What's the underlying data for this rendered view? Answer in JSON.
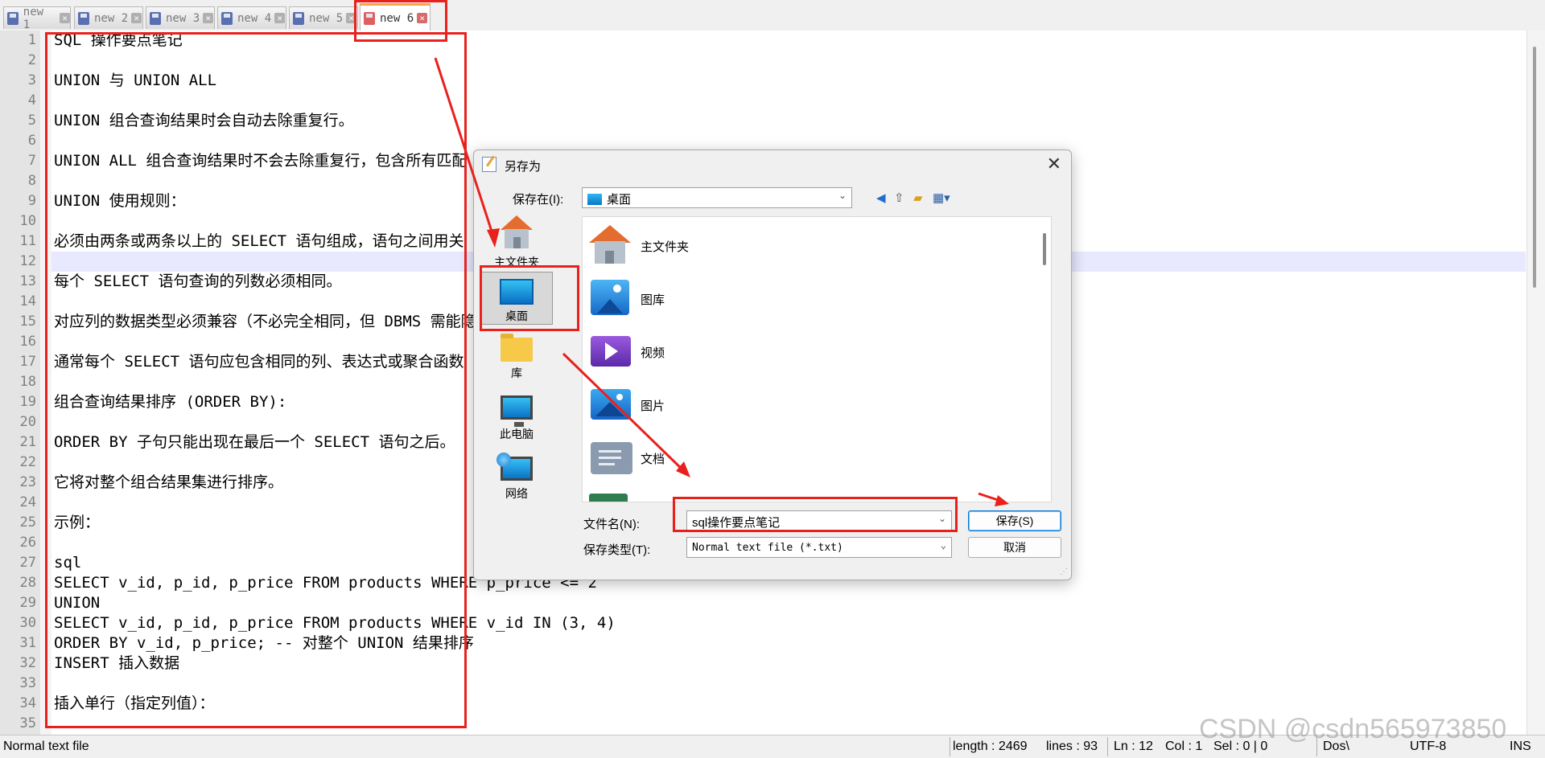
{
  "tabs": [
    {
      "label": "new 1"
    },
    {
      "label": "new 2"
    },
    {
      "label": "new 3"
    },
    {
      "label": "new 4"
    },
    {
      "label": "new 5"
    },
    {
      "label": "new 6",
      "active": true
    }
  ],
  "editor": {
    "line_numbers": [
      "1",
      "2",
      "3",
      "4",
      "5",
      "6",
      "7",
      "8",
      "9",
      "10",
      "11",
      "12",
      "13",
      "14",
      "15",
      "16",
      "17",
      "18",
      "19",
      "20",
      "21",
      "22",
      "23",
      "24",
      "25",
      "26",
      "27",
      "28",
      "29",
      "30",
      "31",
      "32",
      "33",
      "34",
      "35"
    ],
    "lines": [
      "SQL 操作要点笔记",
      "",
      "UNION 与 UNION ALL",
      "",
      "UNION 组合查询结果时会自动去除重复行。",
      "",
      "UNION ALL 组合查询结果时不会去除重复行，包含所有匹配",
      "",
      "UNION 使用规则：",
      "",
      "必须由两条或两条以上的 SELECT 语句组成，语句之间用关",
      "",
      "每个 SELECT 语句查询的列数必须相同。",
      "",
      "对应列的数据类型必须兼容（不必完全相同，但 DBMS 需能隐",
      "",
      "通常每个 SELECT 语句应包含相同的列、表达式或聚合函数",
      "",
      "组合查询结果排序 (ORDER BY):",
      "",
      "ORDER BY 子句只能出现在最后一个 SELECT 语句之后。",
      "",
      "它将对整个组合结果集进行排序。",
      "",
      "示例：",
      "",
      "sql",
      "SELECT v_id, p_id, p_price FROM products WHERE p_price <= 2",
      "UNION",
      "SELECT v_id, p_id, p_price FROM products WHERE v_id IN (3, 4)",
      "ORDER BY v_id, p_price; -- 对整个 UNION 结果排序",
      "INSERT 插入数据",
      "",
      "插入单行（指定列值）：",
      ""
    ]
  },
  "status": {
    "file_type": "Normal text file",
    "length": "length : 2469",
    "lines": "lines : 93",
    "ln": "Ln : 12",
    "col": "Col : 1",
    "sel": "Sel : 0 | 0",
    "eol": "Dos\\",
    "encoding": "UTF-8",
    "mode": "INS"
  },
  "watermark": "CSDN @csdn565973850",
  "dialog": {
    "title": "另存为",
    "save_in_label": "保存在(I):",
    "save_in_value": "桌面",
    "places": [
      {
        "label": "主文件夹",
        "icon": "home-icon"
      },
      {
        "label": "桌面",
        "icon": "desktop-icon",
        "selected": true
      },
      {
        "label": "库",
        "icon": "library-icon"
      },
      {
        "label": "此电脑",
        "icon": "computer-icon"
      },
      {
        "label": "网络",
        "icon": "network-icon"
      }
    ],
    "files": [
      {
        "label": "主文件夹",
        "icon": "home-icon"
      },
      {
        "label": "图库",
        "icon": "gallery-icon"
      },
      {
        "label": "视频",
        "icon": "videos-icon"
      },
      {
        "label": "图片",
        "icon": "pictures-icon"
      },
      {
        "label": "文档",
        "icon": "documents-icon"
      }
    ],
    "filename_label": "文件名(N):",
    "filename_value": "sql操作要点笔记",
    "filetype_label": "保存类型(T):",
    "filetype_value": "Normal text file (*.txt)",
    "save_button": "保存(S)",
    "cancel_button": "取消"
  },
  "colors": {
    "annotation_red": "#e8211d",
    "current_line": "#e8e8ff"
  }
}
